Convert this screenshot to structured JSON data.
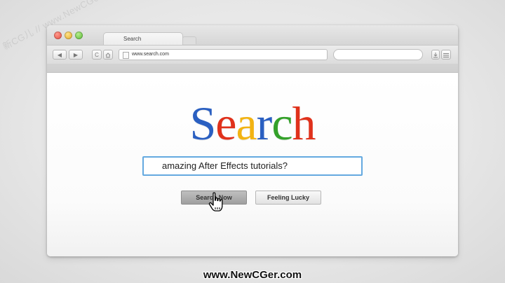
{
  "watermark_top": "新CG儿 // www.NewCGer.com //",
  "watermark_bottom": "www.NewCGer.com",
  "browser": {
    "tab_title": "Search",
    "url": "www.search.com",
    "nav": {
      "back": "◀",
      "forward": "▶",
      "reload": "C"
    }
  },
  "page": {
    "logo_letters": [
      {
        "ch": "S",
        "color": "#2a5fc1"
      },
      {
        "ch": "e",
        "color": "#e0311b"
      },
      {
        "ch": "a",
        "color": "#f2b312"
      },
      {
        "ch": "r",
        "color": "#2a5fc1"
      },
      {
        "ch": "c",
        "color": "#34a12a"
      },
      {
        "ch": "h",
        "color": "#e0311b"
      }
    ],
    "query": "amazing After Effects tutorials?",
    "search_button": "Search Now",
    "lucky_button": "Feeling Lucky"
  }
}
